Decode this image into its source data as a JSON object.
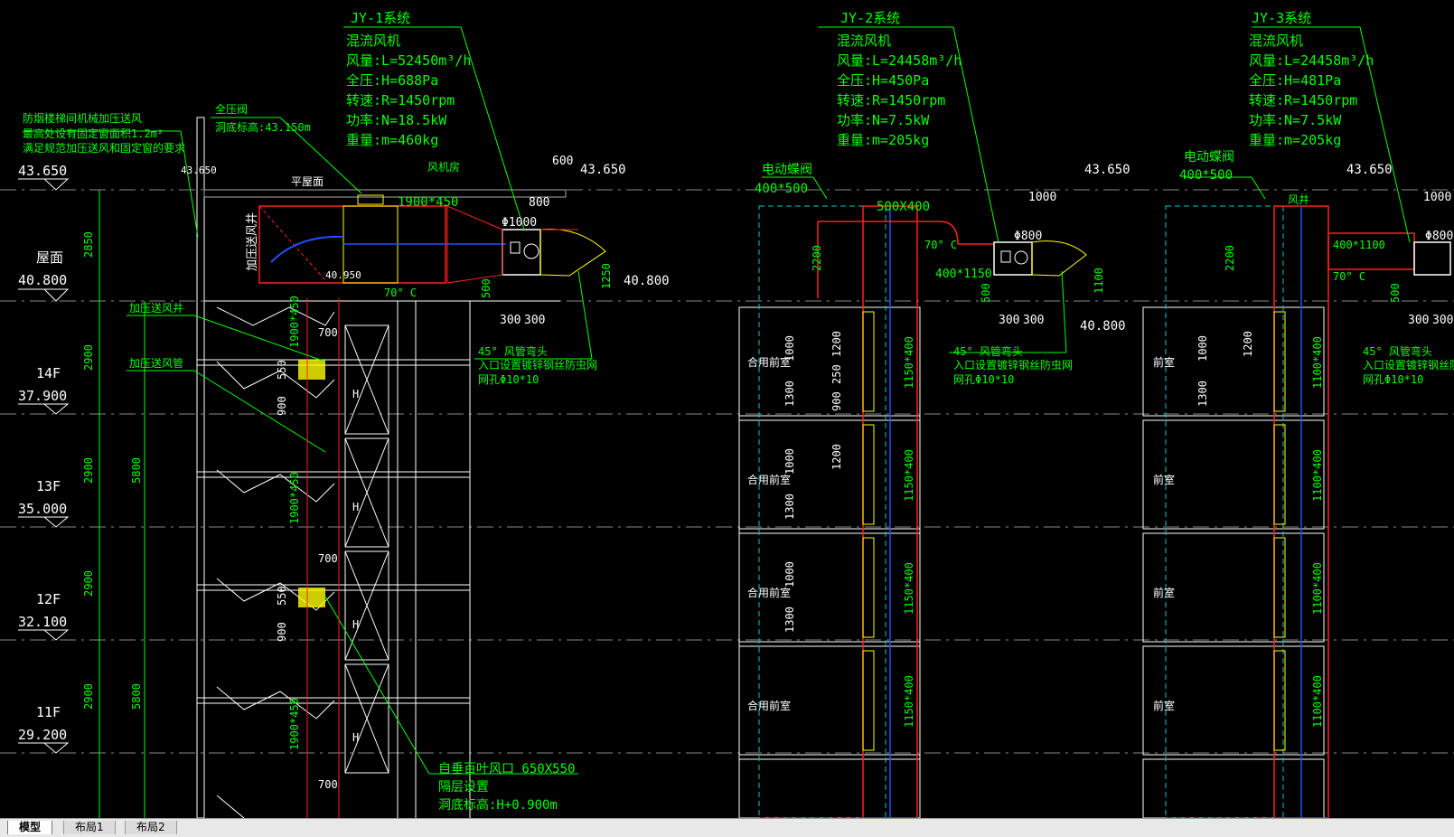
{
  "systems": [
    {
      "title": "JY-1系统",
      "fan": "混流风机",
      "flow": "风量:L=52450m³/h",
      "pressure": "全压:H=688Pa",
      "speed": "转速:R=1450rpm",
      "power": "功率:N=18.5kW",
      "weight": "重量:m=460kg"
    },
    {
      "title": "JY-2系统",
      "fan": "混流风机",
      "flow": "风量:L=24458m³/h",
      "pressure": "全压:H=450Pa",
      "speed": "转速:R=1450rpm",
      "power": "功率:N=7.5kW",
      "weight": "重量:m=205kg"
    },
    {
      "title": "JY-3系统",
      "fan": "混流风机",
      "flow": "风量:L=24458m³/h",
      "pressure": "全压:H=481Pa",
      "speed": "转速:R=1450rpm",
      "power": "功率:N=7.5kW",
      "weight": "重量:m=205kg"
    }
  ],
  "floors": [
    {
      "name": "屋面",
      "elev": "40.800"
    },
    {
      "name": "14F",
      "elev": "37.900"
    },
    {
      "name": "13F",
      "elev": "35.000"
    },
    {
      "name": "12F",
      "elev": "32.100"
    },
    {
      "name": "11F",
      "elev": "29.200"
    }
  ],
  "top_elev": "43.650",
  "notes": {
    "smokeproof": [
      "防烟楼梯间机械加压送风",
      "最高处设有固定窗面积1.2m²",
      "满足规范加压送风和固定窗的要求"
    ],
    "valve": [
      "全压阀",
      "洞底标高:43.150m"
    ],
    "roof_level": "平屋面",
    "fan_room": "风机房",
    "shaft_label": "加压送风井",
    "shaft_label2": "加压送风井",
    "duct_label": "加压送风管",
    "elbow1": [
      "45° 风管弯头",
      "入口设置镀锌钢丝防虫网",
      "网孔Φ10*10"
    ],
    "elbow2": [
      "45° 风管弯头",
      "入口设置镀锌钢丝防虫网",
      "网孔Φ10*10"
    ],
    "elbow3": [
      "45° 风管弯头",
      "入口设置镀锌钢丝防虫网",
      "网孔Φ10*10"
    ],
    "louver": [
      "自垂百叶风口 650X550",
      "隔层设置",
      "洞底标高:H+0.900m"
    ],
    "motor_damper": [
      "电动蝶阀",
      "400*500"
    ],
    "motor_damper2": [
      "电动蝶阀",
      "400*500"
    ],
    "shaft_small": "风井",
    "room_combined": "合用前室",
    "room_front": "前室",
    "duct_1900": "1900*450",
    "duct_500": "500X400",
    "duct_1150": "1150*400",
    "duct_1100": "1100*400",
    "dim_400_1150": "400*1150",
    "dim_400_1100": "400*1100",
    "temp": "70° C",
    "elev_4095": "40.950",
    "elev_4080": "40.800"
  },
  "dims": {
    "d600": "600",
    "d800": "800",
    "d1000": "1000",
    "d300": "300",
    "d500": "500",
    "d1250": "1250",
    "d1100": "1100",
    "d2850": "2850",
    "d2900": "2900",
    "d5800": "5800",
    "d2200": "2200",
    "d1000b": "1000",
    "d1300": "1300",
    "d1200": "1200",
    "d250": "250",
    "d900": "900",
    "d700": "700",
    "d550": "550",
    "d1900": "1900*450",
    "phi1000": "Φ1000",
    "phi800": "Φ800"
  },
  "tabs": [
    {
      "label": "模型",
      "active": true
    },
    {
      "label": "布局1",
      "active": false
    },
    {
      "label": "布局2",
      "active": false
    }
  ],
  "colors": {
    "green": "#00ff00",
    "red": "#ff2020",
    "blue": "#2050ff",
    "cyan": "#00c8c8",
    "yellow": "#ffff00",
    "white": "#ffffff",
    "gray": "#9a9a9a"
  }
}
